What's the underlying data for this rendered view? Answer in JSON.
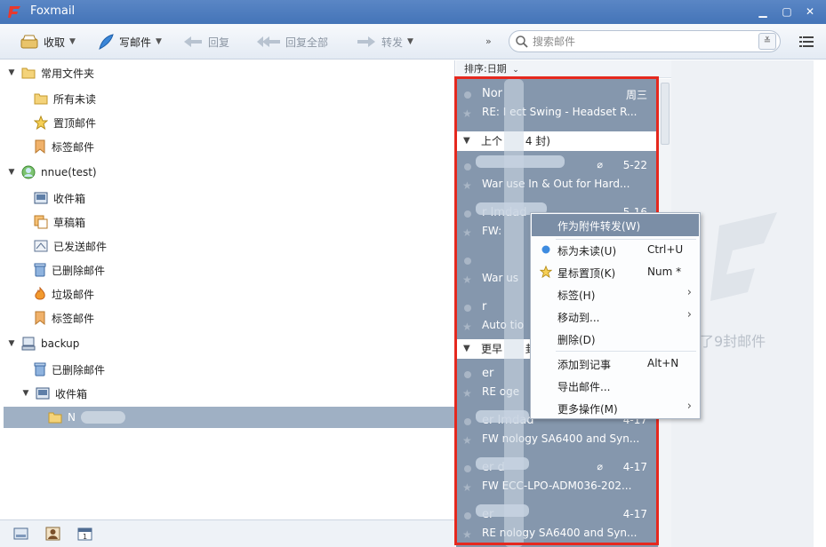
{
  "window": {
    "title": "Foxmail"
  },
  "toolbar": {
    "receive": "收取",
    "compose": "写邮件",
    "reply": "回复",
    "reply_all": "回复全部",
    "forward": "转发",
    "more": "»",
    "search_placeholder": "搜索邮件"
  },
  "folders": {
    "common": "常用文件夹",
    "all_unread": "所有未读",
    "pinned": "置顶邮件",
    "tagged": "标签邮件",
    "account1": "nnue(test)",
    "inbox": "收件箱",
    "drafts": "草稿箱",
    "sent": "已发送邮件",
    "deleted": "已删除邮件",
    "junk": "垃圾邮件",
    "tagged2": "标签邮件",
    "account2": "backup",
    "deleted2": "已删除邮件",
    "inbox2": "收件箱",
    "sub_folder": "N"
  },
  "maillist": {
    "sort_label": "排序:日期",
    "groups": {
      "last_month": "上个",
      "last_month_count": "4 封)",
      "earlier": "更早",
      "earlier_count": "封"
    },
    "mails": [
      {
        "sender": "Nor",
        "date": "周三",
        "subject": "RE: I    ect Swing - Headset R..."
      },
      {
        "sender": "",
        "date": "5-22",
        "subject": "War     use In & Out for Hard..."
      },
      {
        "sender": "      r Imdad",
        "date": "5-16",
        "subject": "FW:"
      },
      {
        "sender": "",
        "date": "",
        "subject": "War     us"
      },
      {
        "sender": "      r",
        "date": "",
        "subject": "Auto     tio"
      },
      {
        "sender": "      er",
        "date": "",
        "subject": "RE      oge"
      },
      {
        "sender": "      er Imdad",
        "date": "4-17",
        "subject": "FW      nology SA6400 and Syn..."
      },
      {
        "sender": "      er      d",
        "date": "4-17",
        "subject": "FW      ECC-LPO-ADM036-202..."
      },
      {
        "sender": "      er",
        "date": "4-17",
        "subject": "RE      nology SA6400 and Syn..."
      }
    ]
  },
  "preview": {
    "count_text": "选取了9封邮件"
  },
  "context_menu": {
    "forward_as_attachment": "作为附件转发(W)",
    "mark_unread": "标为未读(U)",
    "mark_unread_key": "Ctrl+U",
    "star_pin": "星标置顶(K)",
    "star_pin_key": "Num *",
    "tag": "标签(H)",
    "move_to": "移动到...",
    "delete": "删除(D)",
    "add_note": "添加到记事",
    "add_note_key": "Alt+N",
    "export": "导出邮件...",
    "more_actions": "更多操作(M)"
  },
  "colors": {
    "accent": "#4474b8",
    "selection": "#8597ad",
    "highlight": "#e5281e"
  }
}
